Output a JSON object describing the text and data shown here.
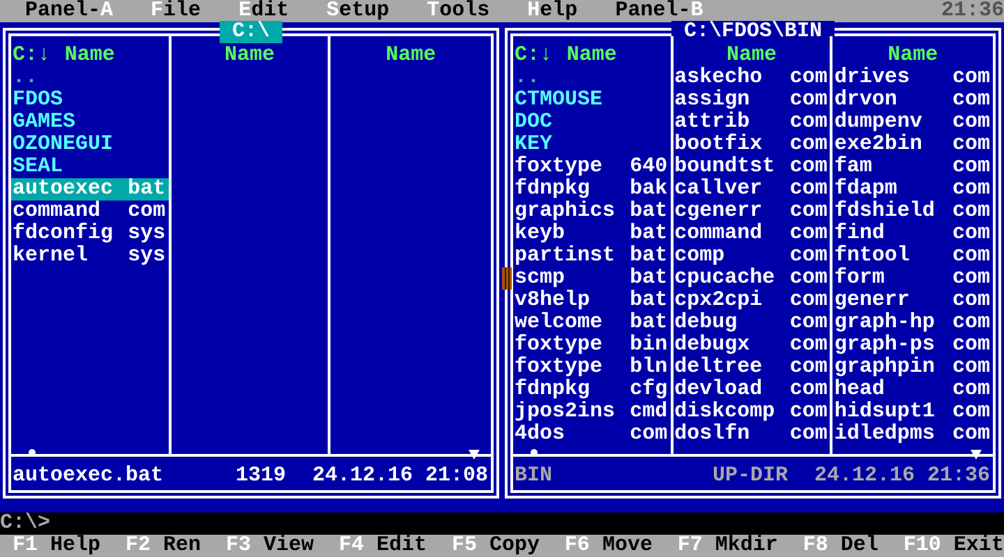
{
  "menu": {
    "items": [
      {
        "label": "Panel-**A**"
      },
      {
        "label": "**F**ile"
      },
      {
        "label": "**E**dit"
      },
      {
        "label": "**S**etup"
      },
      {
        "label": "**T**ools"
      },
      {
        "label": "**H**elp"
      },
      {
        "label": "Panel-**B**"
      }
    ],
    "clock": "21:36"
  },
  "panels": [
    {
      "title": "C:\\",
      "active": true,
      "sort_indicator": "C:↓",
      "columns": [
        {
          "header": "Name",
          "files": [
            {
              "name": "..",
              "kind": "updir",
              "selected": false
            },
            {
              "name": "FDOS",
              "kind": "dir",
              "selected": false
            },
            {
              "name": "GAMES",
              "kind": "dir",
              "selected": false
            },
            {
              "name": "OZONEGUI",
              "kind": "dir",
              "selected": false
            },
            {
              "name": "SEAL",
              "kind": "dir",
              "selected": false
            },
            {
              "name": "autoexec",
              "ext": "bat",
              "kind": "file",
              "selected": true
            },
            {
              "name": "command",
              "ext": "com",
              "kind": "file",
              "selected": false
            },
            {
              "name": "fdconfig",
              "ext": "sys",
              "kind": "file",
              "selected": false
            },
            {
              "name": "kernel",
              "ext": "sys",
              "kind": "file",
              "selected": false
            }
          ]
        },
        {
          "header": "Name"
        },
        {
          "header": "Name"
        }
      ],
      "info": {
        "name": "autoexec.bat",
        "size": "1319",
        "date": "24.12.16 21:08"
      }
    },
    {
      "title": "C:\\FDOS\\BIN",
      "active": false,
      "sort_indicator": "C:↓",
      "columns": [
        {
          "header": "Name",
          "files": [
            {
              "name": "..",
              "kind": "updir",
              "selected": false
            },
            {
              "name": "CTMOUSE",
              "kind": "dir",
              "selected": false
            },
            {
              "name": "DOC",
              "kind": "dir",
              "selected": false
            },
            {
              "name": "KEY",
              "kind": "dir",
              "selected": false
            },
            {
              "name": "foxtype",
              "ext": "640",
              "kind": "file",
              "selected": false
            },
            {
              "name": "fdnpkg",
              "ext": "bak",
              "kind": "file",
              "selected": false
            },
            {
              "name": "graphics",
              "ext": "bat",
              "kind": "file",
              "selected": false
            },
            {
              "name": "keyb",
              "ext": "bat",
              "kind": "file",
              "selected": false
            },
            {
              "name": "partinst",
              "ext": "bat",
              "kind": "file",
              "selected": false
            },
            {
              "name": "scmp",
              "ext": "bat",
              "kind": "file",
              "selected": false
            },
            {
              "name": "v8help",
              "ext": "bat",
              "kind": "file",
              "selected": false
            },
            {
              "name": "welcome",
              "ext": "bat",
              "kind": "file",
              "selected": false
            },
            {
              "name": "foxtype",
              "ext": "bin",
              "kind": "file",
              "selected": false
            },
            {
              "name": "foxtype",
              "ext": "bln",
              "kind": "file",
              "selected": false
            },
            {
              "name": "fdnpkg",
              "ext": "cfg",
              "kind": "file",
              "selected": false
            },
            {
              "name": "jpos2ins",
              "ext": "cmd",
              "kind": "file",
              "selected": false
            },
            {
              "name": "4dos",
              "ext": "com",
              "kind": "file",
              "selected": false
            }
          ]
        },
        {
          "header": "Name",
          "files": [
            {
              "name": "askecho",
              "ext": "com",
              "kind": "file",
              "selected": false
            },
            {
              "name": "assign",
              "ext": "com",
              "kind": "file",
              "selected": false
            },
            {
              "name": "attrib",
              "ext": "com",
              "kind": "file",
              "selected": false
            },
            {
              "name": "bootfix",
              "ext": "com",
              "kind": "file",
              "selected": false
            },
            {
              "name": "boundtst",
              "ext": "com",
              "kind": "file",
              "selected": false
            },
            {
              "name": "callver",
              "ext": "com",
              "kind": "file",
              "selected": false
            },
            {
              "name": "cgenerr",
              "ext": "com",
              "kind": "file",
              "selected": false
            },
            {
              "name": "command",
              "ext": "com",
              "kind": "file",
              "selected": false
            },
            {
              "name": "comp",
              "ext": "com",
              "kind": "file",
              "selected": false
            },
            {
              "name": "cpucache",
              "ext": "com",
              "kind": "file",
              "selected": false
            },
            {
              "name": "cpx2cpi",
              "ext": "com",
              "kind": "file",
              "selected": false
            },
            {
              "name": "debug",
              "ext": "com",
              "kind": "file",
              "selected": false
            },
            {
              "name": "debugx",
              "ext": "com",
              "kind": "file",
              "selected": false
            },
            {
              "name": "deltree",
              "ext": "com",
              "kind": "file",
              "selected": false
            },
            {
              "name": "devload",
              "ext": "com",
              "kind": "file",
              "selected": false
            },
            {
              "name": "diskcomp",
              "ext": "com",
              "kind": "file",
              "selected": false
            },
            {
              "name": "doslfn",
              "ext": "com",
              "kind": "file",
              "selected": false
            }
          ]
        },
        {
          "header": "Name",
          "files": [
            {
              "name": "drives",
              "ext": "com",
              "kind": "file",
              "selected": false
            },
            {
              "name": "drvon",
              "ext": "com",
              "kind": "file",
              "selected": false
            },
            {
              "name": "dumpenv",
              "ext": "com",
              "kind": "file",
              "selected": false
            },
            {
              "name": "exe2bin",
              "ext": "com",
              "kind": "file",
              "selected": false
            },
            {
              "name": "fam",
              "ext": "com",
              "kind": "file",
              "selected": false
            },
            {
              "name": "fdapm",
              "ext": "com",
              "kind": "file",
              "selected": false
            },
            {
              "name": "fdshield",
              "ext": "com",
              "kind": "file",
              "selected": false
            },
            {
              "name": "find",
              "ext": "com",
              "kind": "file",
              "selected": false
            },
            {
              "name": "fntool",
              "ext": "com",
              "kind": "file",
              "selected": false
            },
            {
              "name": "form",
              "ext": "com",
              "kind": "file",
              "selected": false
            },
            {
              "name": "generr",
              "ext": "com",
              "kind": "file",
              "selected": false
            },
            {
              "name": "graph-hp",
              "ext": "com",
              "kind": "file",
              "selected": false
            },
            {
              "name": "graph-ps",
              "ext": "com",
              "kind": "file",
              "selected": false
            },
            {
              "name": "graphpin",
              "ext": "com",
              "kind": "file",
              "selected": false
            },
            {
              "name": "head",
              "ext": "com",
              "kind": "file",
              "selected": false
            },
            {
              "name": "hidsupt1",
              "ext": "com",
              "kind": "file",
              "selected": false
            },
            {
              "name": "idledpms",
              "ext": "com",
              "kind": "file",
              "selected": false
            }
          ]
        }
      ],
      "info": {
        "name": "BIN",
        "size": "UP-DIR",
        "date": "24.12.16 21:36"
      }
    }
  ],
  "command_line": {
    "prompt": "C:\\>"
  },
  "function_keys": [
    {
      "key": "F1",
      "label": "Help"
    },
    {
      "key": "F2",
      "label": "Ren"
    },
    {
      "key": "F3",
      "label": "View"
    },
    {
      "key": "F4",
      "label": "Edit"
    },
    {
      "key": "F5",
      "label": "Copy"
    },
    {
      "key": "F6",
      "label": "Move"
    },
    {
      "key": "F7",
      "label": "Mkdir"
    },
    {
      "key": "F8",
      "label": "Del"
    },
    {
      "key": "F10",
      "label": "Exit"
    }
  ]
}
